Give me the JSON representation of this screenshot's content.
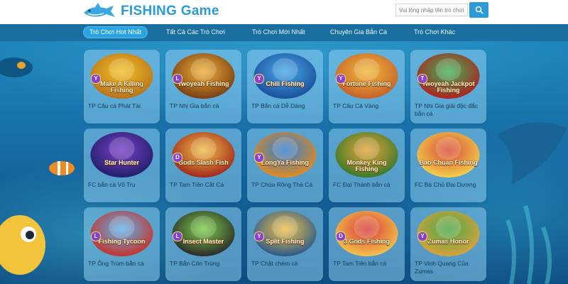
{
  "header": {
    "logo_text": "FISHING Game",
    "search_placeholder": "Vui lòng nhập tên trò chơi",
    "brand_color": "#2a9ad8"
  },
  "nav": {
    "items": [
      {
        "label": "Trò Chơi Hot Nhất",
        "active": true
      },
      {
        "label": "Tất Cả Các Trò Chơi",
        "active": false
      },
      {
        "label": "Trò Chơi Mới Nhất",
        "active": false
      },
      {
        "label": "Chuyên Gia Bắn Cá",
        "active": false
      },
      {
        "label": "Trò Chơi Khác",
        "active": false
      }
    ]
  },
  "games": [
    {
      "logo": "Make A Killing Fishing",
      "title": "TP Câu cá Phát Tài",
      "badge": "Y"
    },
    {
      "logo": "Twoyeah Fishing",
      "title": "TP Nhị Gia bắn cá",
      "badge": "L"
    },
    {
      "logo": "Chili Fishing",
      "title": "TP Bắn cá Dễ Dàng",
      "badge": "Y"
    },
    {
      "logo": "Fortune Fishing",
      "title": "TP Câu Cá Vàng",
      "badge": "Y"
    },
    {
      "logo": "Twoyeah Jackpot Fishing",
      "title": "TP Nhị Gia giải độc đắc bắn cá",
      "badge": "T"
    },
    {
      "logo": "Star Hunter",
      "title": "FC bắn cá Vũ Trụ",
      "badge": ""
    },
    {
      "logo": "Gods Slash Fish",
      "title": "TP Tam Tiên Cắt Cá",
      "badge": "D"
    },
    {
      "logo": "LongYa Fishing",
      "title": "TP Chúa Rồng Thả Cá",
      "badge": "Y"
    },
    {
      "logo": "Monkey King Fishing",
      "title": "FC Đại Thánh bắn cá",
      "badge": ""
    },
    {
      "logo": "Bao Chuan Fishing",
      "title": "FC Bá Chủ Đại Dương",
      "badge": ""
    },
    {
      "logo": "Fishing Tycoon",
      "title": "TP Ông Trùm bắn cá",
      "badge": "L"
    },
    {
      "logo": "Insect Master",
      "title": "TP Bắn Côn Trùng",
      "badge": "L"
    },
    {
      "logo": "Split Fishing",
      "title": "TP Chặt chém cá",
      "badge": "Y"
    },
    {
      "logo": "3 Gods Fishing",
      "title": "TP Tam Tiên bắn cá",
      "badge": "D"
    },
    {
      "logo": "Zumas Honor",
      "title": "TP Vinh Quang Của Zumas",
      "badge": "Y"
    }
  ]
}
